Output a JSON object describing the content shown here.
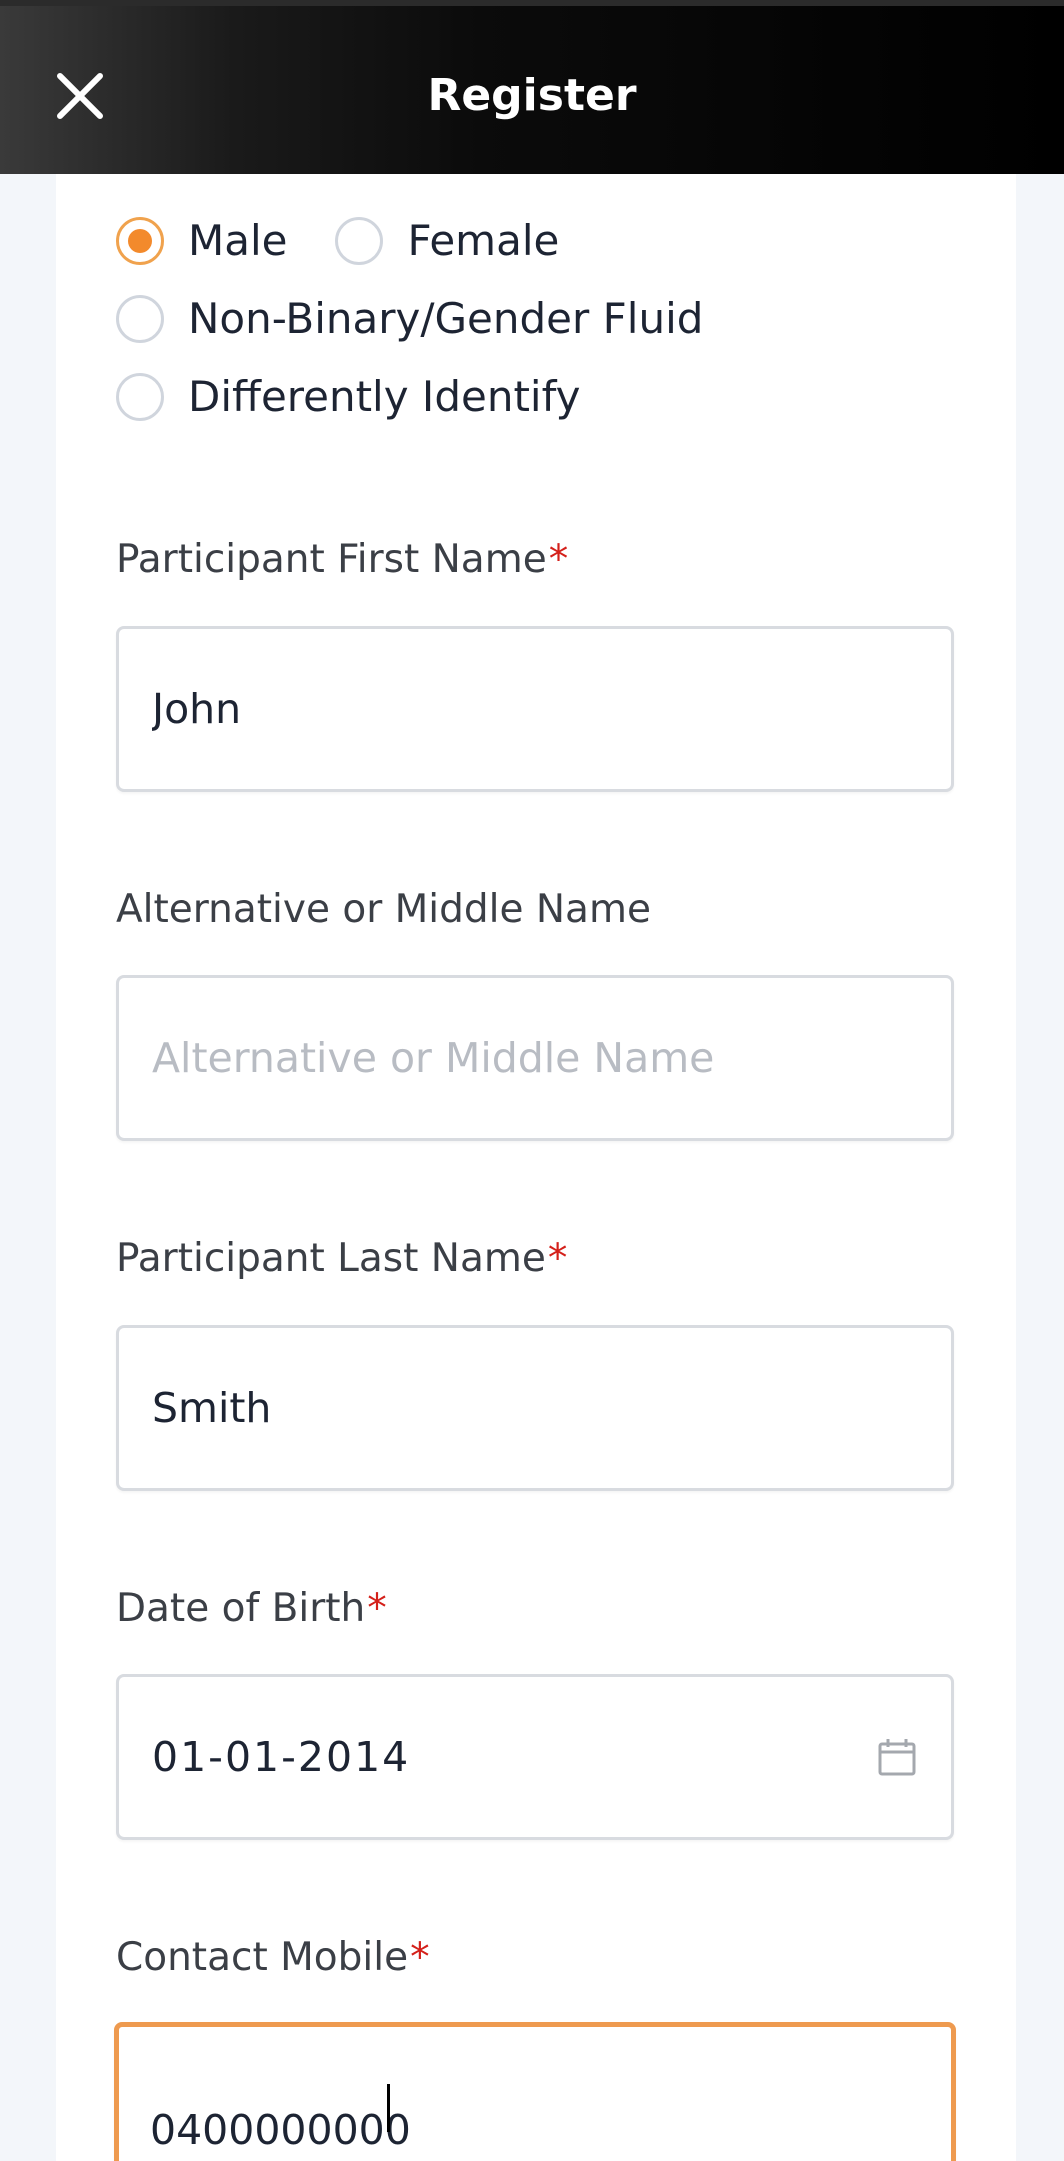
{
  "header": {
    "title": "Register",
    "close_icon": "close-icon"
  },
  "gender": {
    "options": [
      {
        "label": "Male",
        "checked": true
      },
      {
        "label": "Female",
        "checked": false
      },
      {
        "label": "Non-Binary/Gender Fluid",
        "checked": false
      },
      {
        "label": "Differently Identify",
        "checked": false
      }
    ]
  },
  "fields": {
    "first_name": {
      "label": "Participant First Name",
      "required_mark": "*",
      "value": "John"
    },
    "middle_name": {
      "label": "Alternative or Middle Name",
      "placeholder": "Alternative or Middle Name",
      "value": ""
    },
    "last_name": {
      "label": "Participant Last Name",
      "required_mark": "*",
      "value": "Smith"
    },
    "dob": {
      "label": "Date of Birth",
      "required_mark": "*",
      "value": "01-01-2014",
      "icon": "calendar-icon"
    },
    "mobile": {
      "label": "Contact Mobile",
      "required_mark": "*",
      "value": "0400000000"
    }
  },
  "colors": {
    "accent": "#f38a2c",
    "focus_border": "#ee9a4f",
    "required": "#d4201a",
    "page_bg": "#f3f6fa"
  }
}
